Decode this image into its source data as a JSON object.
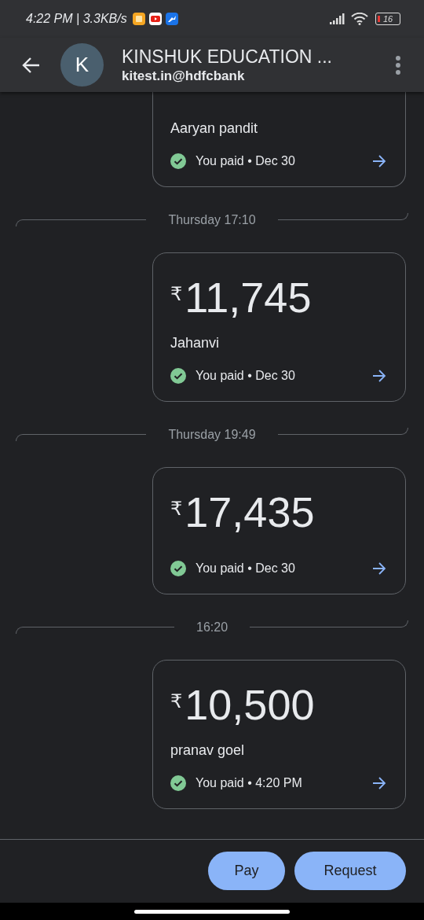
{
  "status_bar": {
    "time_speed": "4:22 PM | 3.3KB/s",
    "battery": "16"
  },
  "header": {
    "avatar_letter": "K",
    "title": "KINSHUK EDUCATION ...",
    "subtitle": "kitest.in@hdfcbank"
  },
  "messages": [
    {
      "kind": "payment",
      "name": "Aaryan pandit",
      "status": "You paid • Dec 30"
    },
    {
      "kind": "separator",
      "label": "Thursday 17:10"
    },
    {
      "kind": "payment",
      "currency": "₹",
      "amount": "11,745",
      "name": "Jahanvi",
      "status": "You paid • Dec 30"
    },
    {
      "kind": "separator",
      "label": "Thursday 19:49"
    },
    {
      "kind": "payment",
      "currency": "₹",
      "amount": "17,435",
      "status": "You paid • Dec 30"
    },
    {
      "kind": "separator",
      "label": "16:20"
    },
    {
      "kind": "payment",
      "currency": "₹",
      "amount": "10,500",
      "name": "pranav goel",
      "status": "You paid • 4:20 PM"
    }
  ],
  "actions": [
    "Pay",
    "Request"
  ]
}
